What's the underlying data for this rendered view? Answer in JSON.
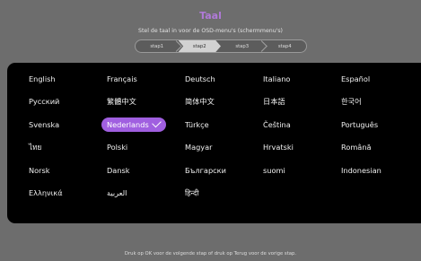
{
  "page": {
    "title": "Taal",
    "subtitle": "Stel de taal in voor de OSD-menu's (schermmenu's)",
    "footer": "Druk op OK voor de volgende stap of druk op Terug voor de vorige stap."
  },
  "stepper": {
    "steps": [
      "stap1",
      "stap2",
      "stap3",
      "stap4"
    ],
    "active_index": 1
  },
  "languages": [
    [
      "English",
      "Français",
      "Deutsch",
      "Italiano",
      "Español"
    ],
    [
      "Русский",
      "繁體中文",
      "简体中文",
      "日本語",
      "한국어"
    ],
    [
      "Svenska",
      "Nederlands",
      "Türkçe",
      "Čeština",
      "Português"
    ],
    [
      "ไทย",
      "Polski",
      "Magyar",
      "Hrvatski",
      "Română"
    ],
    [
      "Norsk",
      "Dansk",
      "Български",
      "suomi",
      "Indonesian"
    ],
    [
      "Ελληνικά",
      "العربية",
      "हिन्दी"
    ]
  ],
  "selected_language": "Nederlands",
  "colors": {
    "accent": "#a05fe0",
    "title": "#b07ad8",
    "background": "#6d6d6d",
    "panel": "#000000"
  },
  "icons": {
    "selected_marker": "checkmark-icon"
  }
}
